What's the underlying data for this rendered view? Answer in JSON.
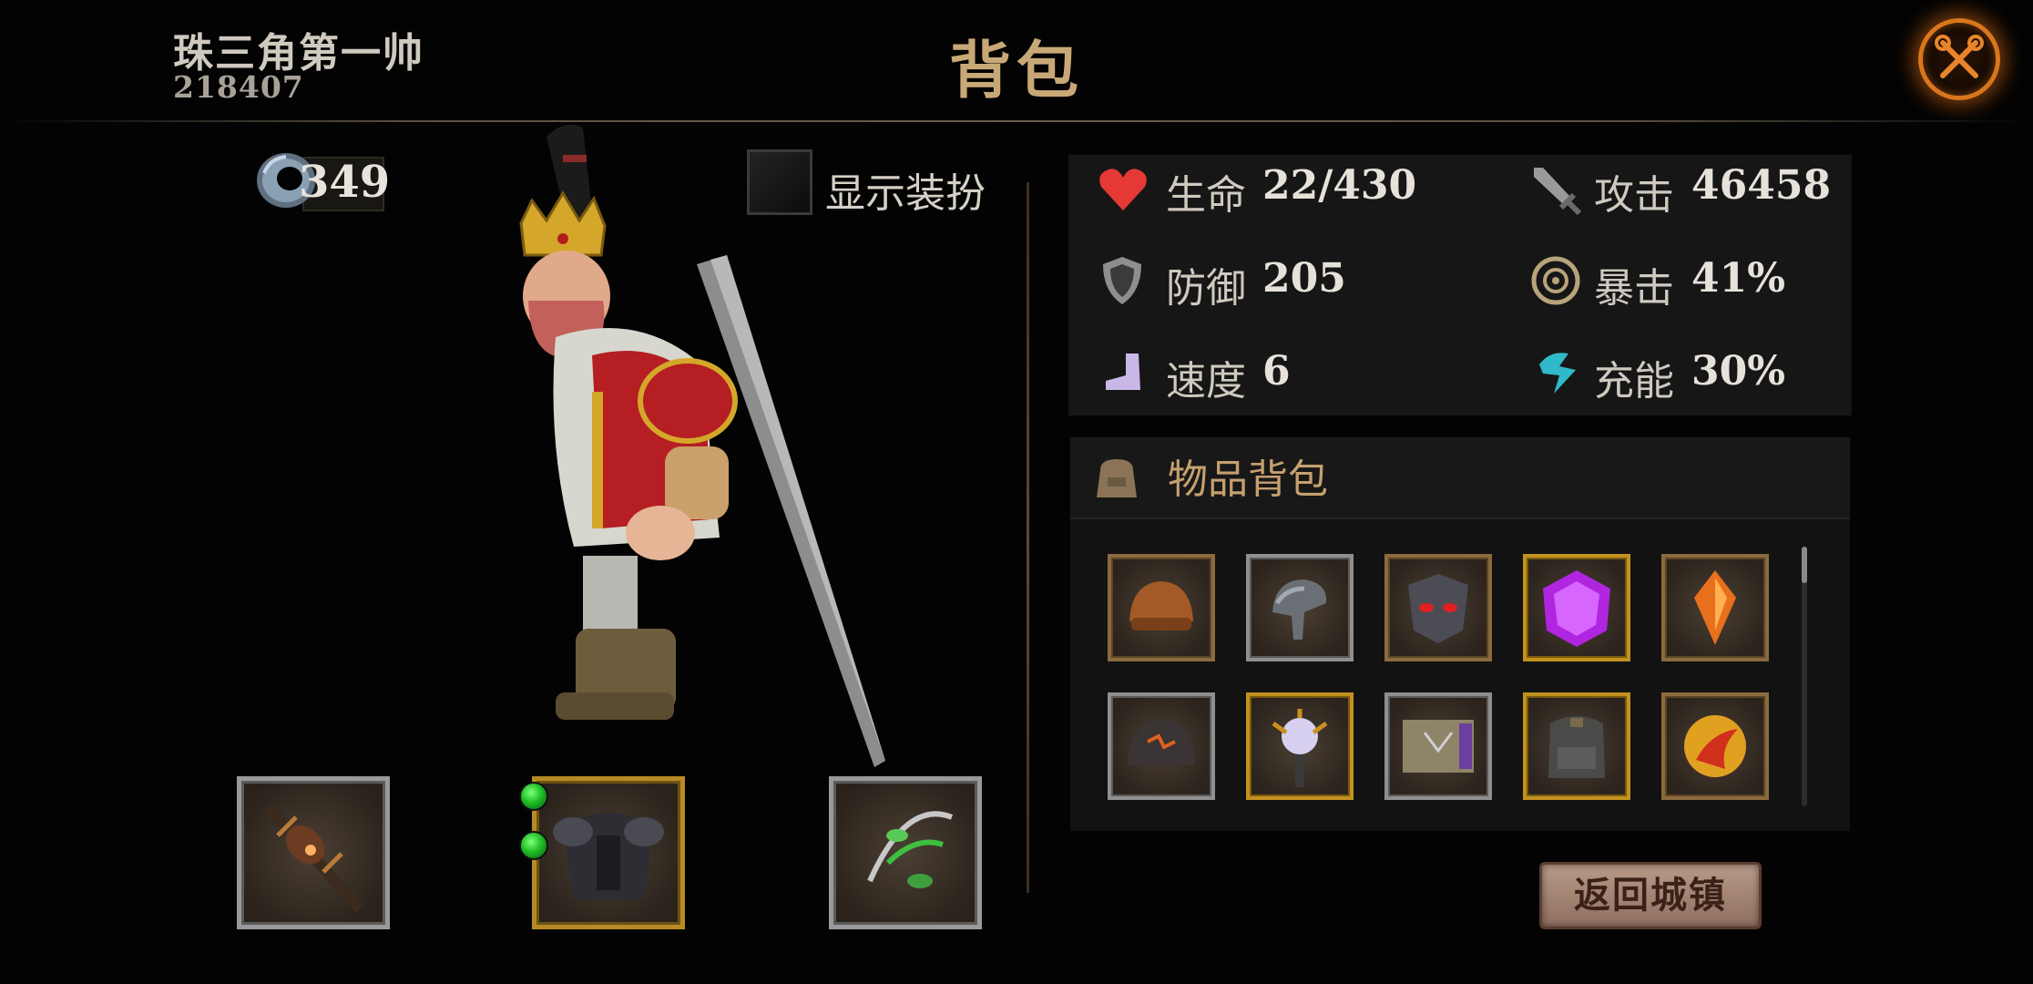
{
  "header": {
    "player_name": "珠三角第一帅",
    "player_id": "218407",
    "title": "背包"
  },
  "currency": {
    "icon": "ring-stone-icon",
    "value": "349"
  },
  "costume": {
    "label": "显示装扮",
    "checked": false
  },
  "stats": [
    {
      "icon": "heart-icon",
      "label": "生命",
      "value": "22/430",
      "color": "#e53935"
    },
    {
      "icon": "sword-icon",
      "label": "攻击",
      "value": "46458",
      "color": "#8c8c8c"
    },
    {
      "icon": "shield-icon",
      "label": "防御",
      "value": "205",
      "color": "#9e9e9e"
    },
    {
      "icon": "crit-icon",
      "label": "暴击",
      "value": "41%",
      "color": "#b8a47a"
    },
    {
      "icon": "boot-icon",
      "label": "速度",
      "value": "6",
      "color": "#c9b7e8"
    },
    {
      "icon": "energy-icon",
      "label": "充能",
      "value": "30%",
      "color": "#2fb9c9"
    }
  ],
  "inventory": {
    "title": "物品背包",
    "icon": "bag-icon",
    "items": [
      {
        "name": "leather-cap",
        "rarity": "bronze"
      },
      {
        "name": "iron-helm",
        "rarity": "silver"
      },
      {
        "name": "demon-mask",
        "rarity": "bronze"
      },
      {
        "name": "purple-gem",
        "rarity": "gold"
      },
      {
        "name": "amber-crystal",
        "rarity": "bronze"
      },
      {
        "name": "lava-helm",
        "rarity": "silver"
      },
      {
        "name": "orb-scepter",
        "rarity": "gold"
      },
      {
        "name": "rune-bracer",
        "rarity": "silver"
      },
      {
        "name": "iron-backpack",
        "rarity": "gold"
      },
      {
        "name": "fire-orb",
        "rarity": "bronze"
      }
    ]
  },
  "equipment": [
    {
      "name": "spiked-mace",
      "rarity": "silver"
    },
    {
      "name": "dark-armor",
      "rarity": "gold",
      "sockets": 2
    },
    {
      "name": "vine-bow",
      "rarity": "silver"
    }
  ],
  "return_button": "返回城镇",
  "colors": {
    "accent": "#c9a877",
    "close_ring": "#d8761c",
    "gold_frame": "#b88a24"
  }
}
